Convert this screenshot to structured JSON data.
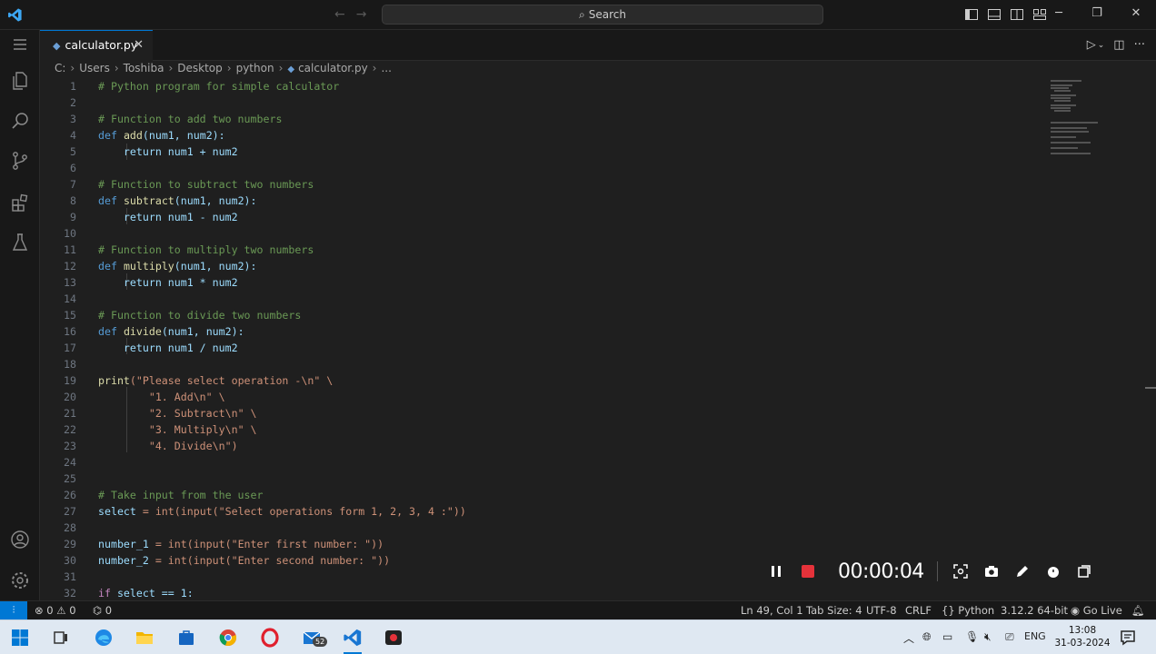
{
  "titlebar": {
    "search_placeholder": "Search"
  },
  "tab": {
    "filename": "calculator.py",
    "close_glyph": "✕"
  },
  "breadcrumb": {
    "parts": [
      "C:",
      "Users",
      "Toshiba",
      "Desktop",
      "python",
      "calculator.py",
      "..."
    ]
  },
  "code": {
    "lines": [
      {
        "n": "1"
      },
      {
        "n": "2"
      },
      {
        "n": "3"
      },
      {
        "n": "4"
      },
      {
        "n": "5"
      },
      {
        "n": "6"
      },
      {
        "n": "7"
      },
      {
        "n": "8"
      },
      {
        "n": "9"
      },
      {
        "n": "10"
      },
      {
        "n": "11"
      },
      {
        "n": "12"
      },
      {
        "n": "13"
      },
      {
        "n": "14"
      },
      {
        "n": "15"
      },
      {
        "n": "16"
      },
      {
        "n": "17"
      },
      {
        "n": "18"
      },
      {
        "n": "19"
      },
      {
        "n": "20"
      },
      {
        "n": "21"
      },
      {
        "n": "22"
      },
      {
        "n": "23"
      },
      {
        "n": "24"
      },
      {
        "n": "25"
      },
      {
        "n": "26"
      },
      {
        "n": "27"
      },
      {
        "n": "28"
      },
      {
        "n": "29"
      },
      {
        "n": "30"
      },
      {
        "n": "31"
      },
      {
        "n": "32"
      }
    ],
    "text": {
      "l1": "# Python program for simple calculator",
      "l3": "# Function to add two numbers",
      "l4_def": "def",
      "l4_fn": "add",
      "l4_args": "(num1, num2):",
      "l5": "return num1 + num2",
      "l7": "# Function to subtract two numbers",
      "l8_def": "def",
      "l8_fn": "subtract",
      "l8_args": "(num1, num2):",
      "l9": "return num1 - num2",
      "l11": "# Function to multiply two numbers",
      "l12_def": "def",
      "l12_fn": "multiply",
      "l12_args": "(num1, num2):",
      "l13": "return num1 * num2",
      "l15": "# Function to divide two numbers",
      "l16_def": "def",
      "l16_fn": "divide",
      "l16_args": "(num1, num2):",
      "l17": "return num1 / num2",
      "l19_fn": "print",
      "l19_str": "(\"Please select operation -\\n\" \\",
      "l20": "\"1. Add\\n\" \\",
      "l21": "\"2. Subtract\\n\" \\",
      "l22": "\"3. Multiply\\n\" \\",
      "l23": "\"4. Divide\\n\")",
      "l26": "# Take input from the user",
      "l27_var": "select",
      "l27_rest": " = int(input(\"Select operations form 1, 2, 3, 4 :\"))",
      "l29_var": "number_1",
      "l29_rest": " = int(input(\"Enter first number: \"))",
      "l30_var": "number_2",
      "l30_rest": " = int(input(\"Enter second number: \"))",
      "l32_kw": "if",
      "l32_rest": " select == 1:"
    }
  },
  "recorder": {
    "timer": "00:00:04"
  },
  "statusbar": {
    "errors": "0",
    "warnings": "0",
    "ports": "0",
    "position": "Ln 49, Col 1",
    "tab_size": "Tab Size: 4",
    "encoding": "UTF-8",
    "eol": "CRLF",
    "language": "Python",
    "interpreter": "3.12.2 64-bit",
    "go_live": "Go Live"
  },
  "taskbar": {
    "mail_badge": "52",
    "lang": "ENG",
    "time": "13:08",
    "date": "31-03-2024"
  },
  "colors": {
    "accent": "#0078d4",
    "record_red": "#e5323a",
    "editor_bg": "#1f1f1f"
  }
}
